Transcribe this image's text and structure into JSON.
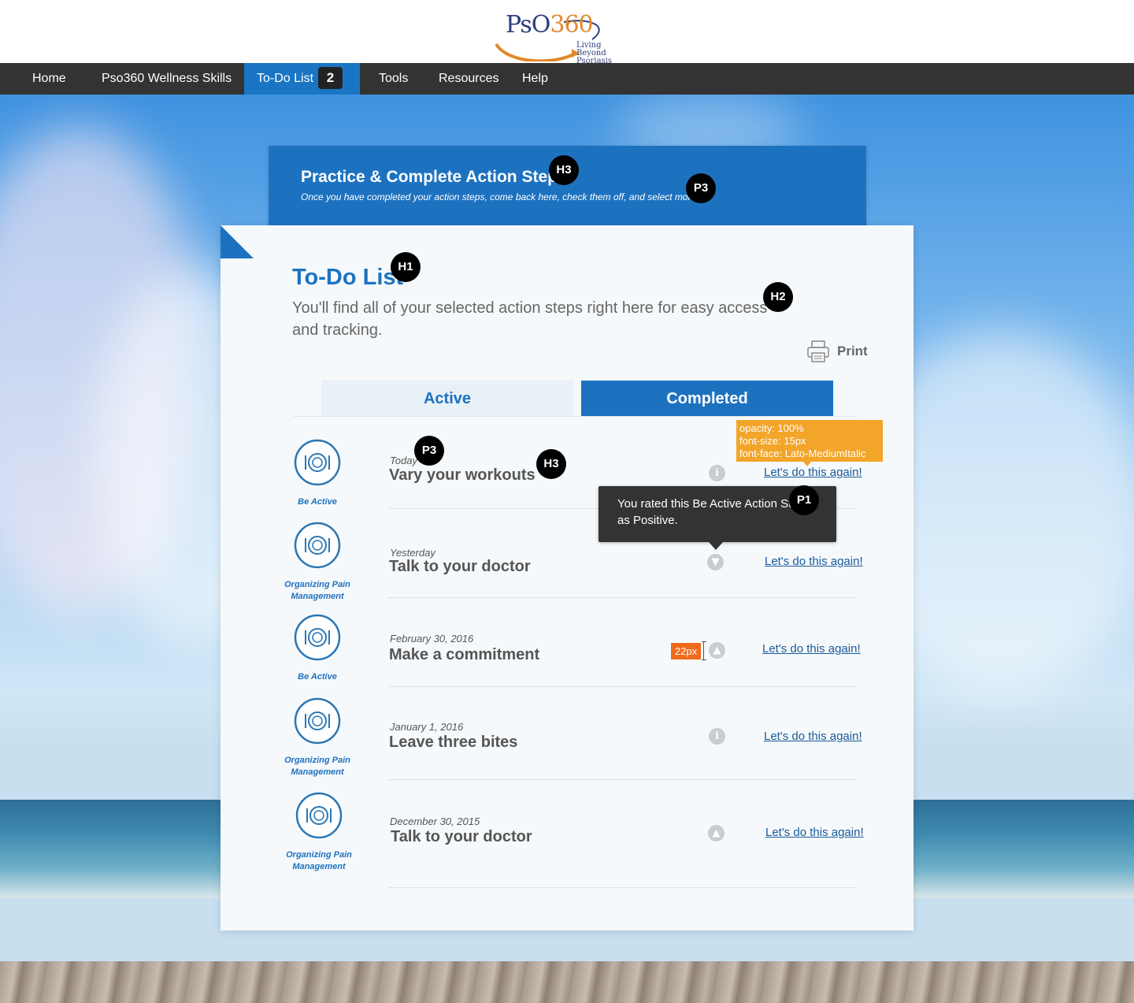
{
  "logo": {
    "brand_prefix": "PsO",
    "brand_number": "360",
    "tagline_1": "Living Beyond",
    "tagline_2": "Psoriasis"
  },
  "nav": {
    "items": [
      {
        "label": "Home"
      },
      {
        "label": "Pso360 Wellness Skills"
      },
      {
        "label": "To-Do List",
        "badge": "2",
        "active": true
      },
      {
        "label": "Tools"
      },
      {
        "label": "Resources"
      },
      {
        "label": "Help"
      }
    ]
  },
  "banner": {
    "title": "Practice & Complete Action Steps",
    "subtitle": "Once you have completed your action steps, come back here, check them off, and select more!"
  },
  "page": {
    "title": "To-Do List",
    "subtitle": "You'll find all of your selected action steps right here for easy access and tracking.",
    "print_label": "Print"
  },
  "tabs": {
    "active": "Active",
    "completed": "Completed"
  },
  "items": [
    {
      "category": "Be Active",
      "date": "Today",
      "title": "Vary your workouts",
      "status": "info",
      "action": "Let's do this again!"
    },
    {
      "category": "Organizing Pain Management",
      "date": "Yesterday",
      "title": "Talk to your doctor",
      "status": "thumbs-down",
      "action": "Let's do this again!"
    },
    {
      "category": "Be Active",
      "date": "February 30, 2016",
      "title": "Make a commitment",
      "status": "thumbs-up",
      "action": "Let's do this again!"
    },
    {
      "category": "Organizing Pain Management",
      "date": "January 1, 2016",
      "title": "Leave three bites",
      "status": "info",
      "action": "Let's do this again!"
    },
    {
      "category": "Organizing Pain Management",
      "date": "December 30, 2015",
      "title": "Talk to your doctor",
      "status": "thumbs-up",
      "action": "Let's do this again!"
    }
  ],
  "tooltip": {
    "text": "You rated this Be Active Action Step as Positive."
  },
  "annotations": {
    "spec_lines": [
      "opacity: 100%",
      "font-size: 15px",
      "font-face: Lato-MediumItalic"
    ],
    "spacing": "22px",
    "tags": [
      "H3",
      "P3",
      "H1",
      "H2",
      "P3",
      "H3",
      "P1"
    ]
  },
  "colors": {
    "brand_blue": "#1d72c0",
    "nav_bg": "#333333",
    "annotation_orange": "#f3a52a",
    "measure_orange": "#f26b1d"
  }
}
